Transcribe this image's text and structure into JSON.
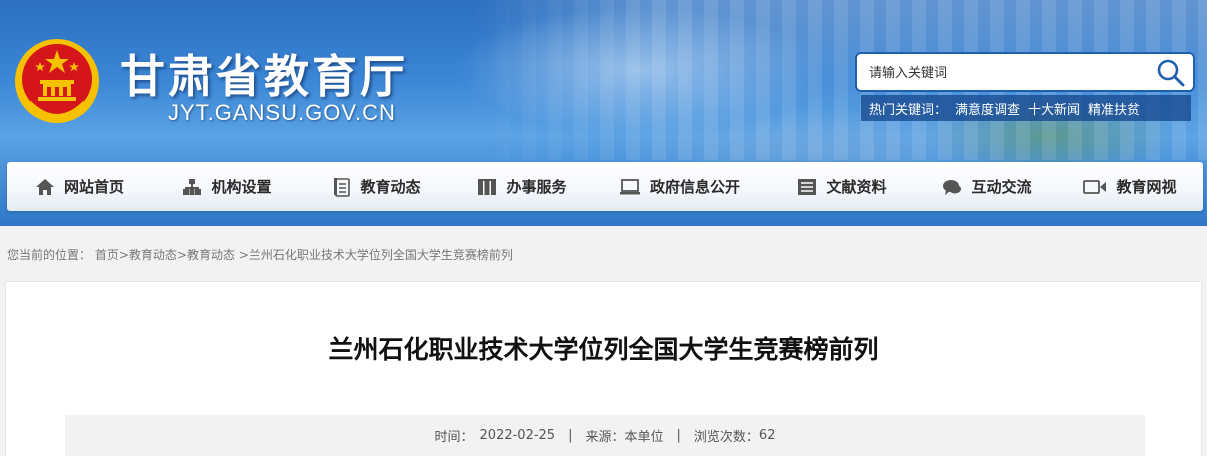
{
  "header": {
    "site_title": "甘肃省教育厅",
    "site_domain": "JYT.GANSU.GOV.CN",
    "emblem_icon": "national-emblem-icon"
  },
  "search": {
    "placeholder": "请输入关键词",
    "icon": "search-icon"
  },
  "hot_keywords": {
    "label": "热门关键词：",
    "items": [
      "满意度调查",
      "十大新闻",
      "精准扶贫"
    ]
  },
  "nav": {
    "items": [
      {
        "label": "网站首页",
        "icon": "home-icon"
      },
      {
        "label": "机构设置",
        "icon": "org-chart-icon"
      },
      {
        "label": "教育动态",
        "icon": "news-icon"
      },
      {
        "label": "办事服务",
        "icon": "service-icon"
      },
      {
        "label": "政府信息公开",
        "icon": "monitor-icon"
      },
      {
        "label": "文献资料",
        "icon": "document-icon"
      },
      {
        "label": "互动交流",
        "icon": "chat-icon"
      },
      {
        "label": "教育网视",
        "icon": "video-icon"
      }
    ]
  },
  "breadcrumb": {
    "prefix": "您当前的位置：",
    "home": "首页",
    "level1": "教育动态",
    "level2": "教育动态",
    "current": "兰州石化职业技术大学位列全国大学生竞赛榜前列"
  },
  "article": {
    "title": "兰州石化职业技术大学位列全国大学生竞赛榜前列",
    "time_label": "时间：",
    "time": "2022-02-25",
    "source_label": "来源：",
    "source": "本单位",
    "views_label": "浏览次数：",
    "views": "62"
  },
  "colors": {
    "banner_blue": "#2f78c8",
    "emblem_red": "#d4161c",
    "emblem_gold": "#f6c200"
  }
}
